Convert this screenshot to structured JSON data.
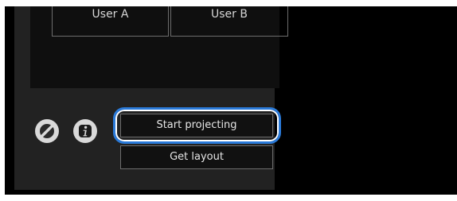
{
  "preview": {
    "users": [
      {
        "label": "User A"
      },
      {
        "label": "User B"
      }
    ]
  },
  "controls": {
    "disable_icon": "no-entry-icon",
    "info_icon": "info-icon",
    "start_projecting_label": "Start projecting",
    "get_layout_label": "Get layout"
  },
  "colors": {
    "panel_background": "#222222",
    "focus_ring": "#2a7ad9"
  }
}
